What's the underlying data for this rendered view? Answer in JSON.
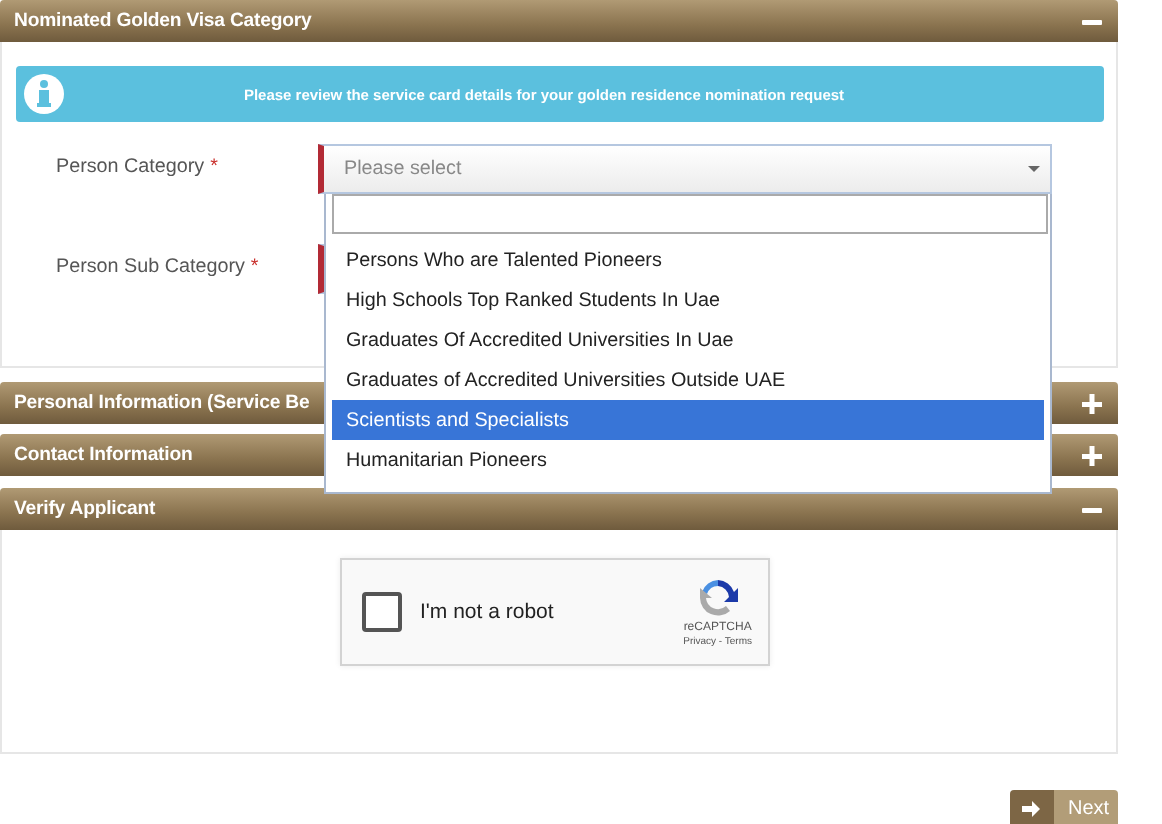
{
  "sections": [
    {
      "kind": "form",
      "title": "Nominated Golden Visa Category",
      "expanded": true,
      "notice": "Please review the service card details for your golden residence nomination request",
      "fields": [
        {
          "label": "Person Category",
          "required_mark": "*",
          "placeholder": "Please select",
          "open": true
        },
        {
          "label": "Person Sub Category",
          "required_mark": "*"
        }
      ],
      "dropdown": {
        "options": [
          {
            "label": "Persons Who are Talented Pioneers",
            "selected": false
          },
          {
            "label": "High Schools Top Ranked Students In Uae",
            "selected": false
          },
          {
            "label": "Graduates Of Accredited Universities In Uae",
            "selected": false
          },
          {
            "label": "Graduates of Accredited Universities Outside UAE",
            "selected": false
          },
          {
            "label": "Scientists and Specialists",
            "selected": true
          },
          {
            "label": "Humanitarian Pioneers",
            "selected": false
          }
        ]
      }
    },
    {
      "title": "Personal Information (Service Be",
      "expanded": false
    },
    {
      "title": "Contact Information",
      "expanded": false
    },
    {
      "kind": "captcha",
      "title": "Verify Applicant",
      "expanded": true,
      "captcha": {
        "label": "I'm not a robot",
        "checked": false,
        "brand": "reCAPTCHA",
        "links": "Privacy - Terms"
      }
    }
  ],
  "next_button": {
    "label": "Next"
  }
}
